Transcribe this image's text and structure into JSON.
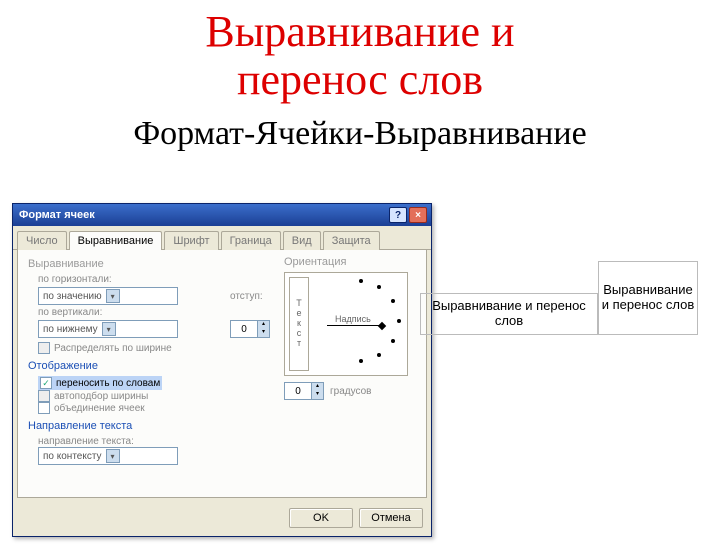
{
  "slide": {
    "title_line1": "Выравнивание и",
    "title_line2": "перенос слов",
    "subtitle": "Формат-Ячейки-Выравнивание"
  },
  "dialog": {
    "title": "Формат ячеек",
    "help_symbol": "?",
    "close_symbol": "×",
    "tabs": [
      "Число",
      "Выравнивание",
      "Шрифт",
      "Граница",
      "Вид",
      "Защита"
    ],
    "active_tab": 1,
    "alignment": {
      "group": "Выравнивание",
      "horiz_label": "по горизонтали:",
      "horiz_value": "по значению",
      "vert_label": "по вертикали:",
      "vert_value": "по нижнему",
      "indent_label": "отступ:",
      "indent_value": "0",
      "distribute": "Распределять по ширине"
    },
    "display": {
      "group": "Отображение",
      "wrap": "переносить по словам",
      "shrink": "автоподбор ширины",
      "merge": "объединение ячеек"
    },
    "direction": {
      "group": "Направление текста",
      "label": "направление текста:",
      "value": "по контексту"
    },
    "orientation": {
      "group": "Ориентация",
      "vertical_text": "Текст",
      "needle_label": "Надпись",
      "degrees_value": "0",
      "degrees_label": "градусов"
    },
    "buttons": {
      "ok": "OK",
      "cancel": "Отмена"
    }
  },
  "examples": {
    "single_line": "Выравнивание и перенос слов",
    "wrapped": "Выравнивание и перенос слов"
  }
}
